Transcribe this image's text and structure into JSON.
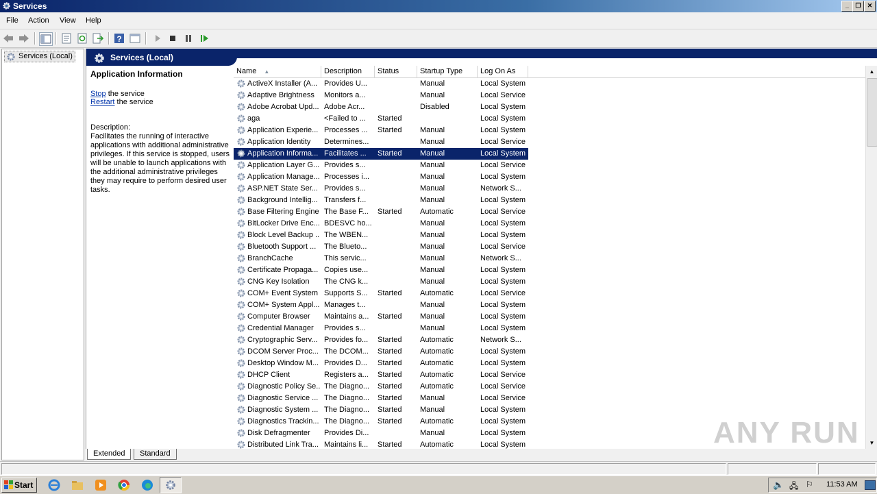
{
  "window": {
    "title": "Services"
  },
  "menu": [
    "File",
    "Action",
    "View",
    "Help"
  ],
  "tree": {
    "root_label": "Services (Local)"
  },
  "header": {
    "title": "Services (Local)"
  },
  "info": {
    "service_name": "Application Information",
    "stop_link": "Stop",
    "stop_rest": " the service",
    "restart_link": "Restart",
    "restart_rest": " the service",
    "description_label": "Description:",
    "description_text": "Facilitates the running of interactive applications with additional administrative privileges.  If this service is stopped, users will be unable to launch applications with the additional administrative privileges they may require to perform desired user tasks."
  },
  "columns": [
    "Name",
    "Description",
    "Status",
    "Startup Type",
    "Log On As"
  ],
  "rows": [
    {
      "name": "ActiveX Installer (A...",
      "desc": "Provides U...",
      "status": "",
      "startup": "Manual",
      "logon": "Local System"
    },
    {
      "name": "Adaptive Brightness",
      "desc": "Monitors a...",
      "status": "",
      "startup": "Manual",
      "logon": "Local Service"
    },
    {
      "name": "Adobe Acrobat Upd...",
      "desc": "Adobe Acr...",
      "status": "",
      "startup": "Disabled",
      "logon": "Local System"
    },
    {
      "name": "aga",
      "desc": "<Failed to ...",
      "status": "Started",
      "startup": "",
      "logon": "Local System"
    },
    {
      "name": "Application Experie...",
      "desc": "Processes ...",
      "status": "Started",
      "startup": "Manual",
      "logon": "Local System"
    },
    {
      "name": "Application Identity",
      "desc": "Determines...",
      "status": "",
      "startup": "Manual",
      "logon": "Local Service"
    },
    {
      "name": "Application Informa...",
      "desc": "Facilitates ...",
      "status": "Started",
      "startup": "Manual",
      "logon": "Local System",
      "selected": true
    },
    {
      "name": "Application Layer G...",
      "desc": "Provides s...",
      "status": "",
      "startup": "Manual",
      "logon": "Local Service"
    },
    {
      "name": "Application Manage...",
      "desc": "Processes i...",
      "status": "",
      "startup": "Manual",
      "logon": "Local System"
    },
    {
      "name": "ASP.NET State Ser...",
      "desc": "Provides s...",
      "status": "",
      "startup": "Manual",
      "logon": "Network S..."
    },
    {
      "name": "Background Intellig...",
      "desc": "Transfers f...",
      "status": "",
      "startup": "Manual",
      "logon": "Local System"
    },
    {
      "name": "Base Filtering Engine",
      "desc": "The Base F...",
      "status": "Started",
      "startup": "Automatic",
      "logon": "Local Service"
    },
    {
      "name": "BitLocker Drive Enc...",
      "desc": "BDESVC ho...",
      "status": "",
      "startup": "Manual",
      "logon": "Local System"
    },
    {
      "name": "Block Level Backup ...",
      "desc": "The WBEN...",
      "status": "",
      "startup": "Manual",
      "logon": "Local System"
    },
    {
      "name": "Bluetooth Support ...",
      "desc": "The Blueto...",
      "status": "",
      "startup": "Manual",
      "logon": "Local Service"
    },
    {
      "name": "BranchCache",
      "desc": "This servic...",
      "status": "",
      "startup": "Manual",
      "logon": "Network S..."
    },
    {
      "name": "Certificate Propaga...",
      "desc": "Copies use...",
      "status": "",
      "startup": "Manual",
      "logon": "Local System"
    },
    {
      "name": "CNG Key Isolation",
      "desc": "The CNG k...",
      "status": "",
      "startup": "Manual",
      "logon": "Local System"
    },
    {
      "name": "COM+ Event System",
      "desc": "Supports S...",
      "status": "Started",
      "startup": "Automatic",
      "logon": "Local Service"
    },
    {
      "name": "COM+ System Appl...",
      "desc": "Manages t...",
      "status": "",
      "startup": "Manual",
      "logon": "Local System"
    },
    {
      "name": "Computer Browser",
      "desc": "Maintains a...",
      "status": "Started",
      "startup": "Manual",
      "logon": "Local System"
    },
    {
      "name": "Credential Manager",
      "desc": "Provides s...",
      "status": "",
      "startup": "Manual",
      "logon": "Local System"
    },
    {
      "name": "Cryptographic Serv...",
      "desc": "Provides fo...",
      "status": "Started",
      "startup": "Automatic",
      "logon": "Network S..."
    },
    {
      "name": "DCOM Server Proc...",
      "desc": "The DCOM...",
      "status": "Started",
      "startup": "Automatic",
      "logon": "Local System"
    },
    {
      "name": "Desktop Window M...",
      "desc": "Provides D...",
      "status": "Started",
      "startup": "Automatic",
      "logon": "Local System"
    },
    {
      "name": "DHCP Client",
      "desc": "Registers a...",
      "status": "Started",
      "startup": "Automatic",
      "logon": "Local Service"
    },
    {
      "name": "Diagnostic Policy Se...",
      "desc": "The Diagno...",
      "status": "Started",
      "startup": "Automatic",
      "logon": "Local Service"
    },
    {
      "name": "Diagnostic Service ...",
      "desc": "The Diagno...",
      "status": "Started",
      "startup": "Manual",
      "logon": "Local Service"
    },
    {
      "name": "Diagnostic System ...",
      "desc": "The Diagno...",
      "status": "Started",
      "startup": "Manual",
      "logon": "Local System"
    },
    {
      "name": "Diagnostics Trackin...",
      "desc": "The Diagno...",
      "status": "Started",
      "startup": "Automatic",
      "logon": "Local System"
    },
    {
      "name": "Disk Defragmenter",
      "desc": "Provides Di...",
      "status": "",
      "startup": "Manual",
      "logon": "Local System"
    },
    {
      "name": "Distributed Link Tra...",
      "desc": "Maintains li...",
      "status": "Started",
      "startup": "Automatic",
      "logon": "Local System"
    }
  ],
  "tabs": [
    "Extended",
    "Standard"
  ],
  "taskbar": {
    "start_label": "Start",
    "clock": "11:53 AM"
  },
  "watermark": "ANY RUN",
  "colors": {
    "selection": "#0a246a",
    "header_band": "#0a246a",
    "link": "#0033aa"
  }
}
